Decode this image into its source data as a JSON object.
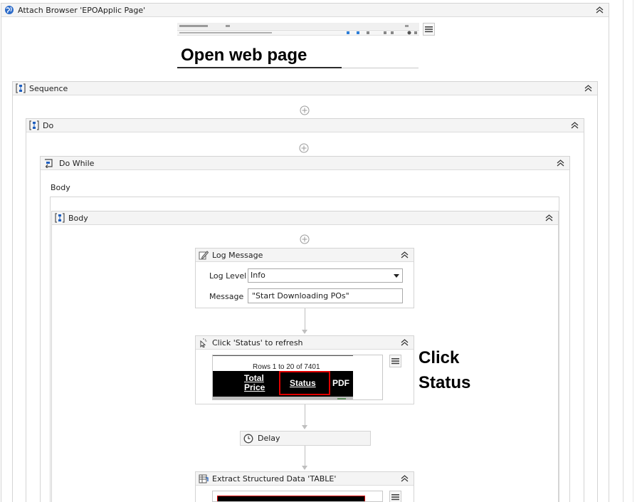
{
  "attach_browser": {
    "title": "Attach Browser 'EPOApplic Page'"
  },
  "annotations": {
    "open_web_page": "Open web page",
    "click_status_line1": "Click",
    "click_status_line2": "Status"
  },
  "sequence": {
    "title": "Sequence"
  },
  "do": {
    "title": "Do"
  },
  "do_while": {
    "title": "Do While",
    "body_label": "Body"
  },
  "body": {
    "title": "Body"
  },
  "log_message": {
    "title": "Log Message",
    "log_level_label": "Log Level",
    "log_level_value": "Info",
    "message_label": "Message",
    "message_value": "\"Start Downloading POs\""
  },
  "click_status": {
    "title": "Click 'Status' to refresh",
    "preview": {
      "rows_text": "Rows 1 to 20 of 7401",
      "col_total_line1": "Total",
      "col_total_line2": "Price",
      "col_status": "Status",
      "col_pdf": "PDF"
    }
  },
  "delay": {
    "title": "Delay"
  },
  "extract": {
    "title": "Extract Structured Data 'TABLE'"
  },
  "colors": {
    "header_bg": "#f4f4f4",
    "border": "#d4d4d4",
    "icon_blue": "#1f5fbf",
    "highlight_red": "#e00000"
  }
}
